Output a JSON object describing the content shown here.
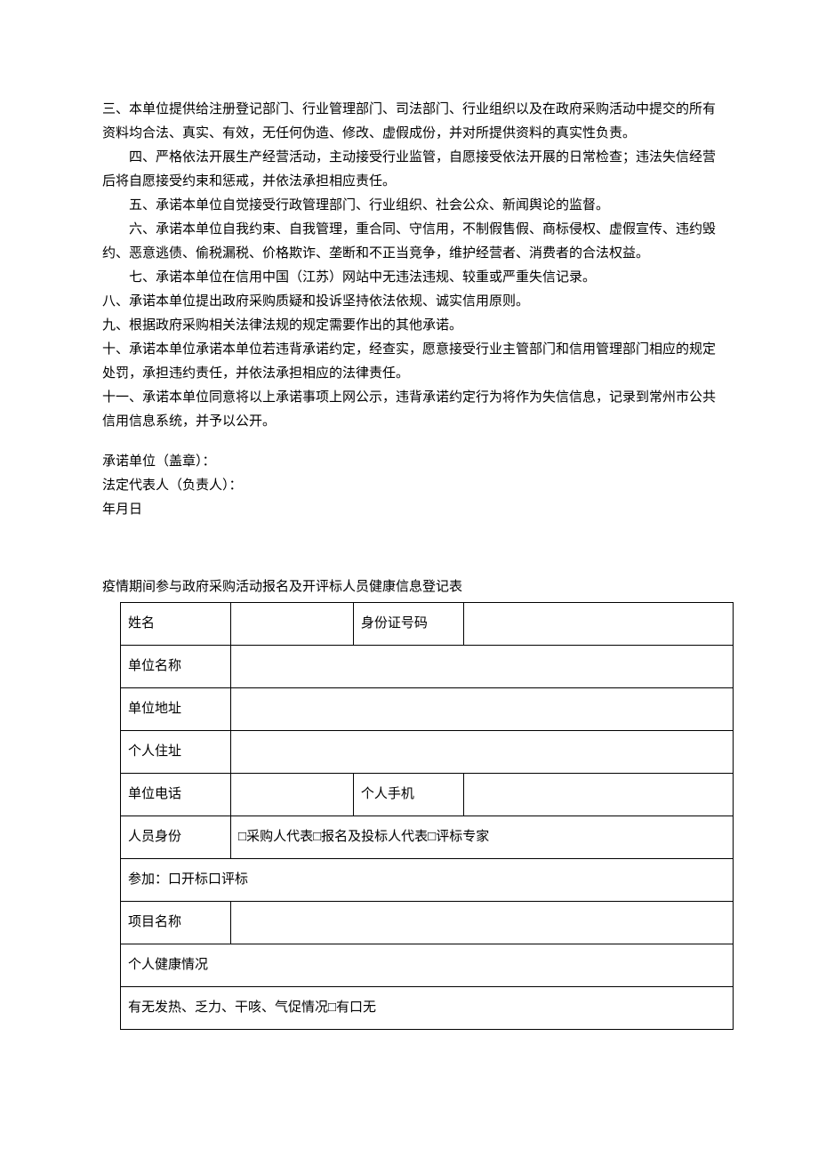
{
  "paragraphs": {
    "p3": "三、本单位提供给注册登记部门、行业管理部门、司法部门、行业组织以及在政府采购活动中提交的所有资料均合法、真实、有效，无任何伪造、修改、虚假成份，并对所提供资料的真实性负责。",
    "p4": "四、严格依法开展生产经营活动，主动接受行业监管，自愿接受依法开展的日常检查；违法失信经营后将自愿接受约束和惩戒，并依法承担相应责任。",
    "p5": "五、承诺本单位自觉接受行政管理部门、行业组织、社会公众、新闻舆论的监督。",
    "p6": "六、承诺本单位自我约束、自我管理，重合同、守信用，不制假售假、商标侵权、虚假宣传、违约毁约、恶意逃债、偷税漏税、价格欺诈、垄断和不正当竞争，维护经营者、消费者的合法权益。",
    "p7": "七、承诺本单位在信用中国（江苏）网站中无违法违规、较重或严重失信记录。",
    "p8": "八、承诺本单位提出政府采购质疑和投诉坚持依法依规、诚实信用原则。",
    "p9": "九、根据政府采购相关法律法规的规定需要作出的其他承诺。",
    "p10": "十、承诺本单位承诺本单位若违背承诺约定，经查实，愿意接受行业主管部门和信用管理部门相应的规定处罚，承担违约责任，并依法承担相应的法律责任。",
    "p11": "十一、承诺本单位同意将以上承诺事项上网公示，违背承诺约定行为将作为失信信息，记录到常州市公共信用信息系统，并予以公开。"
  },
  "signature": {
    "unit": "承诺单位（盖章）：",
    "legal_rep": "法定代表人（负责人）：",
    "date": "年月日"
  },
  "table": {
    "title": "疫情期间参与政府采购活动报名及开评标人员健康信息登记表",
    "rows": {
      "name_label": "姓名",
      "id_label": "身份证号码",
      "unit_name_label": "单位名称",
      "unit_addr_label": "单位地址",
      "personal_addr_label": "个人住址",
      "unit_phone_label": "单位电话",
      "personal_mobile_label": "个人手机",
      "identity_label": "人员身份",
      "identity_value": "□采购人代表□报名及投标人代表□评标专家",
      "participate_label": "参加：口开标口评标",
      "project_name_label": "项目名称",
      "health_label": "个人健康情况",
      "symptoms_label": "有无发热、乏力、干咳、气促情况□有口无"
    }
  }
}
